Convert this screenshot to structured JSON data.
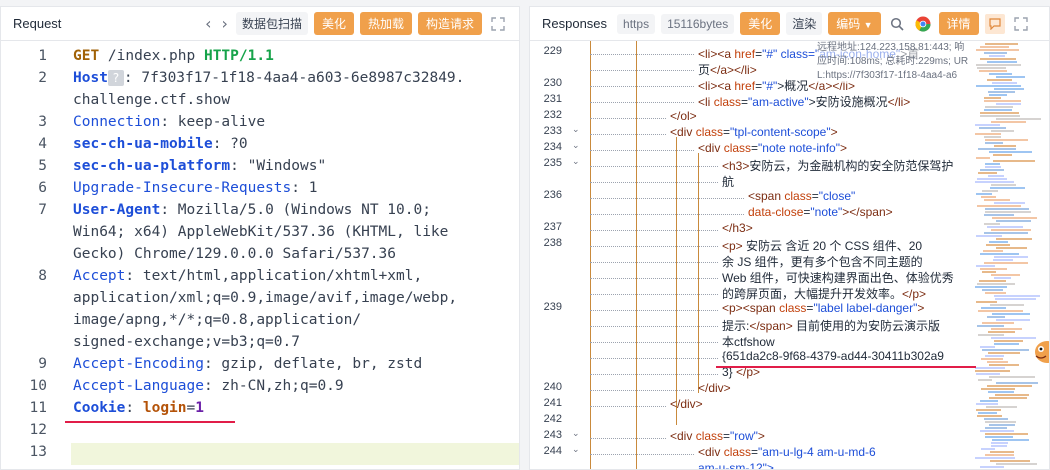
{
  "request": {
    "title": "Request",
    "nav_back": "‹",
    "nav_fwd": "›",
    "toolbar": {
      "scan": "数据包扫描",
      "beautify": "美化",
      "hot_load": "热加载",
      "build_request": "构造请求"
    },
    "lines": [
      {
        "n": "1",
        "parts": [
          {
            "t": "GET",
            "c": "method"
          },
          {
            "t": " /index.php ",
            "c": ""
          },
          {
            "t": "HTTP/1.1",
            "c": "proto"
          }
        ]
      },
      {
        "n": "2",
        "parts": [
          {
            "t": "Host",
            "c": "kb"
          },
          {
            "t": "?",
            "c": "qbadge"
          },
          {
            "t": ": 7f303f17-1f18-4aa4-a603-6e8987c32849.",
            "c": ""
          }
        ]
      },
      {
        "n": "",
        "parts": [
          {
            "t": "challenge.ctf.show",
            "c": ""
          }
        ]
      },
      {
        "n": "3",
        "parts": [
          {
            "t": "Connection",
            "c": "k"
          },
          {
            "t": ": keep-alive",
            "c": ""
          }
        ]
      },
      {
        "n": "4",
        "parts": [
          {
            "t": "sec-ch-ua-mobile",
            "c": "kb"
          },
          {
            "t": ": ?0",
            "c": ""
          }
        ]
      },
      {
        "n": "5",
        "parts": [
          {
            "t": "sec-ch-ua-platform",
            "c": "kb"
          },
          {
            "t": ": \"Windows\"",
            "c": ""
          }
        ]
      },
      {
        "n": "6",
        "parts": [
          {
            "t": "Upgrade-Insecure-Requests",
            "c": "k"
          },
          {
            "t": ": 1",
            "c": ""
          }
        ]
      },
      {
        "n": "7",
        "parts": [
          {
            "t": "User-Agent",
            "c": "kb"
          },
          {
            "t": ": Mozilla/5.0 (Windows NT 10.0;",
            "c": ""
          }
        ]
      },
      {
        "n": "",
        "parts": [
          {
            "t": "Win64; x64) AppleWebKit/537.36 (KHTML, like",
            "c": ""
          }
        ]
      },
      {
        "n": "",
        "parts": [
          {
            "t": "Gecko) Chrome/129.0.0.0 Safari/537.36",
            "c": ""
          }
        ]
      },
      {
        "n": "8",
        "parts": [
          {
            "t": "Accept",
            "c": "k"
          },
          {
            "t": ": text/html,application/xhtml+xml,",
            "c": ""
          }
        ]
      },
      {
        "n": "",
        "parts": [
          {
            "t": "application/xml;q=0.9,image/avif,image/webp,",
            "c": ""
          }
        ]
      },
      {
        "n": "",
        "parts": [
          {
            "t": "image/apng,*/*;q=0.8,application/",
            "c": ""
          }
        ]
      },
      {
        "n": "",
        "parts": [
          {
            "t": "signed-exchange;v=b3;q=0.7",
            "c": ""
          }
        ]
      },
      {
        "n": "9",
        "parts": [
          {
            "t": "Accept-Encoding",
            "c": "k"
          },
          {
            "t": ": gzip, deflate, br, zstd",
            "c": ""
          }
        ]
      },
      {
        "n": "10",
        "parts": [
          {
            "t": "Accept-Language",
            "c": "k"
          },
          {
            "t": ": zh-CN,zh;q=0.9",
            "c": ""
          }
        ]
      },
      {
        "n": "11",
        "parts": [
          {
            "t": "Cookie",
            "c": "cookie-k"
          },
          {
            "t": ": ",
            "c": ""
          },
          {
            "t": "login",
            "c": "cookie-name"
          },
          {
            "t": "=",
            "c": ""
          },
          {
            "t": "1",
            "c": "cookie-val"
          }
        ]
      },
      {
        "n": "12",
        "parts": []
      },
      {
        "n": "13",
        "parts": []
      }
    ]
  },
  "responses": {
    "title": "Responses",
    "protocol": "https",
    "size": "15116bytes",
    "toolbar": {
      "beautify": "美化",
      "render": "渲染",
      "encoding": "编码",
      "details": "详情"
    },
    "tooltip": [
      "远程地址:124.223.158.81:443; 响",
      "应时间:108ms; 总耗时:229ms; UR",
      "L:https://7f303f17-1f18-4aa4-a6"
    ],
    "lines": [
      {
        "n": "229",
        "fold": "",
        "parts": [
          {
            "t": "<li>",
            "c": "tg"
          },
          {
            "t": "<a ",
            "c": "tg"
          },
          {
            "t": "href",
            "c": "at"
          },
          {
            "t": "=",
            "c": "tx"
          },
          {
            "t": "\"#\"",
            "c": "av"
          },
          {
            "t": " class=\"am-icon-home\"",
            "c": "av"
          },
          {
            "t": ">首",
            "c": "tx"
          }
        ]
      },
      {
        "n": "",
        "fold": "",
        "parts": [
          {
            "t": "页",
            "c": "tx"
          },
          {
            "t": "</a>",
            "c": "tg"
          },
          {
            "t": "</li>",
            "c": "tg"
          }
        ]
      },
      {
        "n": "230",
        "fold": "",
        "parts": [
          {
            "t": "<li>",
            "c": "tg"
          },
          {
            "t": "<a ",
            "c": "tg"
          },
          {
            "t": "href",
            "c": "at"
          },
          {
            "t": "=",
            "c": "tx"
          },
          {
            "t": "\"#\"",
            "c": "av"
          },
          {
            "t": ">概况",
            "c": "tx"
          },
          {
            "t": "</a>",
            "c": "tg"
          },
          {
            "t": "</li>",
            "c": "tg"
          }
        ]
      },
      {
        "n": "231",
        "fold": "",
        "parts": [
          {
            "t": "<li ",
            "c": "tg"
          },
          {
            "t": "class",
            "c": "at"
          },
          {
            "t": "=",
            "c": "tx"
          },
          {
            "t": "\"am-active\"",
            "c": "av"
          },
          {
            "t": ">安防设施概况",
            "c": "tx"
          },
          {
            "t": "</li>",
            "c": "tg"
          }
        ]
      },
      {
        "n": "232",
        "fold": "",
        "parts": [
          {
            "t": "</ol>",
            "c": "tg"
          }
        ]
      },
      {
        "n": "233",
        "fold": "⌄",
        "parts": [
          {
            "t": "<div ",
            "c": "tg"
          },
          {
            "t": "class",
            "c": "at"
          },
          {
            "t": "=",
            "c": "tx"
          },
          {
            "t": "\"tpl-content-scope\"",
            "c": "av"
          },
          {
            "t": ">",
            "c": "tg"
          }
        ]
      },
      {
        "n": "234",
        "fold": "⌄",
        "parts": [
          {
            "t": "<div ",
            "c": "tg"
          },
          {
            "t": "class",
            "c": "at"
          },
          {
            "t": "=",
            "c": "tx"
          },
          {
            "t": "\"note note-info\"",
            "c": "av"
          },
          {
            "t": ">",
            "c": "tg"
          }
        ]
      },
      {
        "n": "235",
        "fold": "⌄",
        "parts": [
          {
            "t": "<h3>",
            "c": "tg"
          },
          {
            "t": "安防云，为金融机构的安全防范保驾护",
            "c": "tx"
          }
        ]
      },
      {
        "n": "",
        "fold": "",
        "parts": [
          {
            "t": "航",
            "c": "tx"
          }
        ]
      },
      {
        "n": "236",
        "fold": "",
        "parts": [
          {
            "t": "<span ",
            "c": "tg"
          },
          {
            "t": "class",
            "c": "at"
          },
          {
            "t": "=",
            "c": "tx"
          },
          {
            "t": "\"close\"",
            "c": "av"
          }
        ]
      },
      {
        "n": "",
        "fold": "",
        "parts": [
          {
            "t": "data-close",
            "c": "at"
          },
          {
            "t": "=",
            "c": "tx"
          },
          {
            "t": "\"note\"",
            "c": "av"
          },
          {
            "t": ">",
            "c": "tg"
          },
          {
            "t": "</span>",
            "c": "tg"
          }
        ]
      },
      {
        "n": "237",
        "fold": "",
        "parts": [
          {
            "t": "</h3>",
            "c": "tg"
          }
        ]
      },
      {
        "n": "238",
        "fold": "",
        "parts": [
          {
            "t": "<p>",
            "c": "tg"
          },
          {
            "t": " 安防云 含近 20 个 CSS 组件、20",
            "c": "tx"
          }
        ]
      },
      {
        "n": "",
        "fold": "",
        "parts": [
          {
            "t": "余 JS 组件，更有多个包含不同主题的",
            "c": "tx"
          }
        ]
      },
      {
        "n": "",
        "fold": "",
        "parts": [
          {
            "t": "Web 组件，可快速构建界面出色、体验优秀",
            "c": "tx"
          }
        ]
      },
      {
        "n": "",
        "fold": "",
        "parts": [
          {
            "t": "的跨屏页面，大幅提升开发效率。",
            "c": "tx"
          },
          {
            "t": "</p>",
            "c": "tg"
          }
        ]
      },
      {
        "n": "239",
        "fold": "",
        "parts": [
          {
            "t": "<p>",
            "c": "tg"
          },
          {
            "t": "<span ",
            "c": "tg"
          },
          {
            "t": "class",
            "c": "at"
          },
          {
            "t": "=",
            "c": "tx"
          },
          {
            "t": "\"label label-danger\"",
            "c": "av"
          },
          {
            "t": ">",
            "c": "tg"
          }
        ]
      },
      {
        "n": "",
        "fold": "",
        "parts": [
          {
            "t": "提示:",
            "c": "tx"
          },
          {
            "t": "</span>",
            "c": "tg"
          },
          {
            "t": " 目前使用的为安防云演示版",
            "c": "tx"
          }
        ]
      },
      {
        "n": "",
        "fold": "",
        "parts": [
          {
            "t": "本ctfshow",
            "c": "tx"
          }
        ]
      },
      {
        "n": "",
        "fold": "",
        "parts": [
          {
            "t": "{651da2c8-9f68-4379-ad44-30411b302a9",
            "c": "tx"
          }
        ]
      },
      {
        "n": "",
        "fold": "",
        "parts": [
          {
            "t": "3}",
            "c": "tx"
          },
          {
            "t": "                   </p>",
            "c": "tg"
          }
        ]
      },
      {
        "n": "240",
        "fold": "",
        "parts": [
          {
            "t": "</div>",
            "c": "tg"
          }
        ]
      },
      {
        "n": "241",
        "fold": "",
        "parts": [
          {
            "t": "</div>",
            "c": "tg"
          }
        ]
      },
      {
        "n": "242",
        "fold": "",
        "parts": []
      },
      {
        "n": "243",
        "fold": "⌄",
        "parts": [
          {
            "t": "<div ",
            "c": "tg"
          },
          {
            "t": "class",
            "c": "at"
          },
          {
            "t": "=",
            "c": "tx"
          },
          {
            "t": "\"row\"",
            "c": "av"
          },
          {
            "t": ">",
            "c": "tg"
          }
        ]
      },
      {
        "n": "244",
        "fold": "⌄",
        "parts": [
          {
            "t": "<div ",
            "c": "tg"
          },
          {
            "t": "class",
            "c": "at"
          },
          {
            "t": "=",
            "c": "tx"
          },
          {
            "t": "\"am-u-lg-4 am-u-md-6",
            "c": "av"
          }
        ]
      },
      {
        "n": "",
        "fold": "",
        "parts": [
          {
            "t": "am-u-sm-12\">",
            "c": "av"
          }
        ]
      }
    ]
  },
  "colors": {
    "accent": "#f0a04b",
    "highlight_underline": "#e11d48",
    "active_line": "#f1f6dc"
  },
  "icons": [
    "chevron-left-icon",
    "chevron-right-icon",
    "expand-icon",
    "search-icon",
    "chrome-icon",
    "comment-icon",
    "mascot-icon"
  ]
}
